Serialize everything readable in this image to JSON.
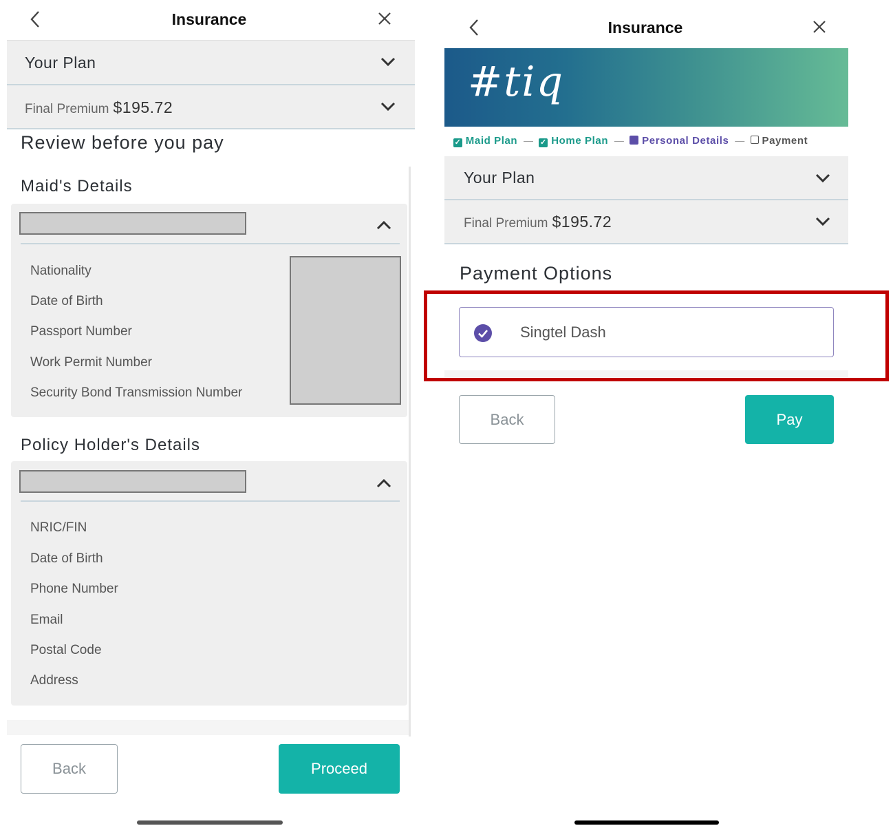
{
  "left": {
    "title": "Insurance",
    "your_plan": "Your Plan",
    "final_premium_label": "Final Premium",
    "final_premium_value": "$195.72",
    "review_heading": "Review before you pay",
    "maid_heading": "Maid's Details",
    "maid_fields": [
      "Nationality",
      "Date of Birth",
      "Passport Number",
      "Work Permit Number",
      "Security Bond Transmission Number"
    ],
    "holder_heading": "Policy Holder's Details",
    "holder_fields": [
      "NRIC/FIN",
      "Date of Birth",
      "Phone Number",
      "Email",
      "Postal Code",
      "Address"
    ],
    "back_label": "Back",
    "proceed_label": "Proceed"
  },
  "right": {
    "title": "Insurance",
    "banner_logo": "#tiq",
    "steps": [
      "Maid Plan",
      "Home Plan",
      "Personal Details",
      "Payment"
    ],
    "your_plan": "Your Plan",
    "final_premium_label": "Final Premium",
    "final_premium_value": "$195.72",
    "payment_heading": "Payment Options",
    "payment_option": "Singtel Dash",
    "back_label": "Back",
    "pay_label": "Pay"
  },
  "colors": {
    "teal": "#14b3a8",
    "purple": "#5c4ea8",
    "highlight_red": "#c00000",
    "step_done": "#1a9a8a"
  }
}
